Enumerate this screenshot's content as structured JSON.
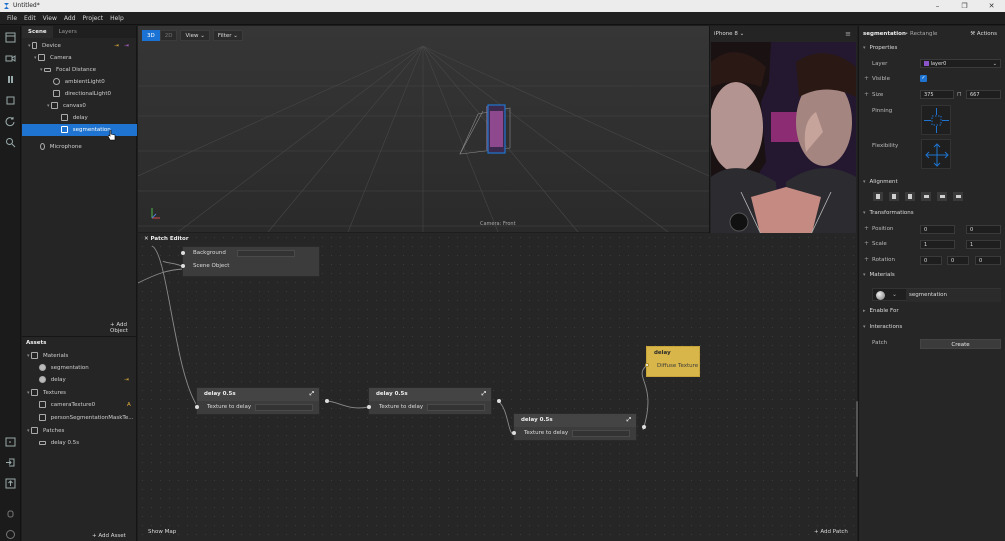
{
  "window": {
    "title": "Untitled*",
    "controls": [
      "–",
      "❐",
      "✕"
    ]
  },
  "menu": [
    "File",
    "Edit",
    "View",
    "Add",
    "Project",
    "Help"
  ],
  "scene": {
    "tabs": [
      "Scene",
      "Layers"
    ],
    "tree": [
      {
        "label": "Device",
        "icon": "device-icon"
      },
      {
        "label": "Camera",
        "icon": "camera-icon"
      },
      {
        "label": "Focal Distance",
        "icon": "focal-distance-icon"
      },
      {
        "label": "ambientLight0",
        "icon": "ambient-light-icon"
      },
      {
        "label": "directionalLight0",
        "icon": "directional-light-icon"
      },
      {
        "label": "canvas0",
        "icon": "canvas-icon"
      },
      {
        "label": "delay",
        "icon": "rectangle-icon"
      },
      {
        "label": "segmentation",
        "icon": "rectangle-icon"
      },
      {
        "label": "Microphone",
        "icon": "microphone-icon"
      }
    ],
    "add_object": "+ Add Object"
  },
  "assets": {
    "title": "Assets",
    "items": [
      {
        "label": "Materials",
        "icon": "folder-icon"
      },
      {
        "label": "segmentation",
        "icon": "material-icon"
      },
      {
        "label": "delay",
        "icon": "material-icon"
      },
      {
        "label": "Textures",
        "icon": "folder-icon"
      },
      {
        "label": "cameraTexture0",
        "icon": "texture-icon"
      },
      {
        "label": "personSegmentationMaskTe...",
        "icon": "texture-icon"
      },
      {
        "label": "Patches",
        "icon": "folder-icon"
      },
      {
        "label": "delay 0.5s",
        "icon": "patch-icon"
      }
    ],
    "add_asset": "+ Add Asset"
  },
  "viewport": {
    "mode_3d": "3D",
    "mode_2d": "2D",
    "view": "View",
    "filter": "Filter",
    "camera_label": "Camera: Front"
  },
  "preview": {
    "device": "iPhone 8"
  },
  "patch_editor": {
    "title": "Patch Editor",
    "show_map": "Show Map",
    "add_patch": "+ Add Patch",
    "nodes": {
      "top": {
        "row1": "Background",
        "row2": "Scene Object"
      },
      "d1": {
        "title": "delay 0.5s",
        "input": "Texture to delay"
      },
      "d2": {
        "title": "delay 0.5s",
        "input": "Texture to delay"
      },
      "d3": {
        "title": "delay 0.5s",
        "input": "Texture to delay"
      },
      "mat": {
        "title": "delay",
        "input": "Diffuse Texture"
      }
    }
  },
  "properties": {
    "object_name": "segmentation",
    "object_type": "• Rectangle",
    "actions": "Actions",
    "sections": {
      "properties": "Properties",
      "alignment": "Alignment",
      "transformations": "Transformations",
      "materials": "Materials",
      "enable_for": "Enable For",
      "interactions": "Interactions"
    },
    "layer_label": "Layer",
    "layer_value": "layer0",
    "visible_label": "Visible",
    "size_label": "Size",
    "size_w": "375",
    "size_h": "667",
    "pinning_label": "Pinning",
    "flexibility_label": "Flexibility",
    "position_label": "Position",
    "position": [
      "0",
      "0"
    ],
    "scale_label": "Scale",
    "scale": [
      "1",
      "1"
    ],
    "rotation_label": "Rotation",
    "rotation": [
      "0",
      "0",
      "0"
    ],
    "material_value": "segmentation",
    "patch_label": "Patch",
    "create": "Create"
  },
  "colors": {
    "accent": "#1e74d0",
    "patch_yellow": "#d9b64a",
    "layer_purple": "#8a55c9"
  }
}
